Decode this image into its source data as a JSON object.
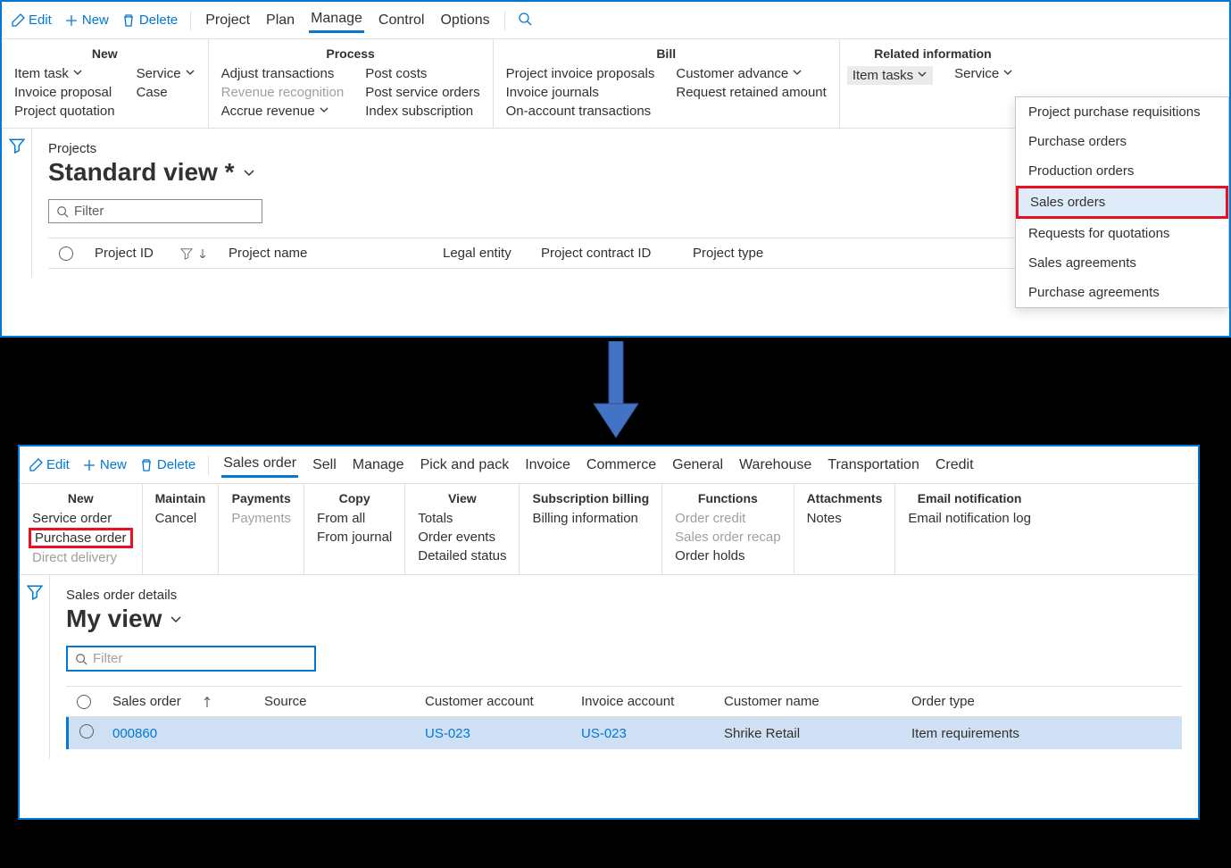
{
  "panel1": {
    "toolbar": {
      "edit": "Edit",
      "new": "New",
      "delete": "Delete",
      "tabs": [
        "Project",
        "Plan",
        "Manage",
        "Control",
        "Options"
      ],
      "active_tab": "Manage"
    },
    "ribbon": {
      "groups": [
        {
          "title": "New",
          "cols": [
            [
              {
                "label": "Item task",
                "chev": true
              },
              {
                "label": "Invoice proposal"
              },
              {
                "label": "Project quotation"
              }
            ],
            [
              {
                "label": "Service",
                "chev": true
              },
              {
                "label": "Case"
              }
            ]
          ]
        },
        {
          "title": "Process",
          "cols": [
            [
              {
                "label": "Adjust transactions"
              },
              {
                "label": "Revenue recognition",
                "disabled": true
              },
              {
                "label": "Accrue revenue",
                "chev": true
              }
            ],
            [
              {
                "label": "Post costs"
              },
              {
                "label": "Post service orders"
              },
              {
                "label": "Index subscription"
              }
            ]
          ]
        },
        {
          "title": "Bill",
          "cols": [
            [
              {
                "label": "Project invoice proposals"
              },
              {
                "label": "Invoice journals"
              },
              {
                "label": "On-account transactions"
              }
            ],
            [
              {
                "label": "Customer advance",
                "chev": true
              },
              {
                "label": "Request retained amount"
              }
            ]
          ]
        },
        {
          "title": "Related information",
          "cols": [
            [
              {
                "label": "Item tasks",
                "chev": true,
                "highlighted": true
              }
            ],
            [
              {
                "label": "Service",
                "chev": true
              }
            ]
          ]
        }
      ]
    },
    "dropdown": [
      {
        "label": "Project purchase requisitions"
      },
      {
        "label": "Purchase orders"
      },
      {
        "label": "Production orders"
      },
      {
        "label": "Sales orders",
        "selected": true
      },
      {
        "label": "Requests for quotations"
      },
      {
        "label": "Sales agreements"
      },
      {
        "label": "Purchase agreements"
      }
    ],
    "content": {
      "breadcrumb": "Projects",
      "view": "Standard view *",
      "filter_placeholder": "Filter",
      "columns": [
        "Project ID",
        "Project name",
        "Legal entity",
        "Project contract ID",
        "Project type"
      ]
    }
  },
  "panel2": {
    "toolbar": {
      "edit": "Edit",
      "new": "New",
      "delete": "Delete",
      "tabs": [
        "Sales order",
        "Sell",
        "Manage",
        "Pick and pack",
        "Invoice",
        "Commerce",
        "General",
        "Warehouse",
        "Transportation",
        "Credit"
      ],
      "active_tab": "Sales order"
    },
    "ribbon": {
      "groups": [
        {
          "title": "New",
          "cols": [
            [
              {
                "label": "Service order"
              },
              {
                "label": "Purchase order",
                "redbox": true
              },
              {
                "label": "Direct delivery",
                "disabled": true
              }
            ]
          ]
        },
        {
          "title": "Maintain",
          "cols": [
            [
              {
                "label": "Cancel"
              }
            ]
          ]
        },
        {
          "title": "Payments",
          "cols": [
            [
              {
                "label": "Payments",
                "disabled": true
              }
            ]
          ]
        },
        {
          "title": "Copy",
          "cols": [
            [
              {
                "label": "From all"
              },
              {
                "label": "From journal"
              }
            ]
          ]
        },
        {
          "title": "View",
          "cols": [
            [
              {
                "label": "Totals"
              },
              {
                "label": "Order events"
              },
              {
                "label": "Detailed status"
              }
            ]
          ]
        },
        {
          "title": "Subscription billing",
          "cols": [
            [
              {
                "label": "Billing information"
              }
            ]
          ]
        },
        {
          "title": "Functions",
          "cols": [
            [
              {
                "label": "Order credit",
                "disabled": true
              },
              {
                "label": "Sales order recap",
                "disabled": true
              },
              {
                "label": "Order holds"
              }
            ]
          ]
        },
        {
          "title": "Attachments",
          "cols": [
            [
              {
                "label": "Notes"
              }
            ]
          ]
        },
        {
          "title": "Email notification",
          "cols": [
            [
              {
                "label": "Email notification log"
              }
            ]
          ]
        }
      ]
    },
    "content": {
      "breadcrumb": "Sales order details",
      "view": "My view",
      "filter_placeholder": "Filter",
      "columns": [
        "Sales order",
        "Source",
        "Customer account",
        "Invoice account",
        "Customer name",
        "Order type"
      ],
      "row": {
        "sales_order": "000860",
        "source": "",
        "cust_acct": "US-023",
        "inv_acct": "US-023",
        "cust_name": "Shrike Retail",
        "order_type": "Item requirements"
      }
    }
  }
}
